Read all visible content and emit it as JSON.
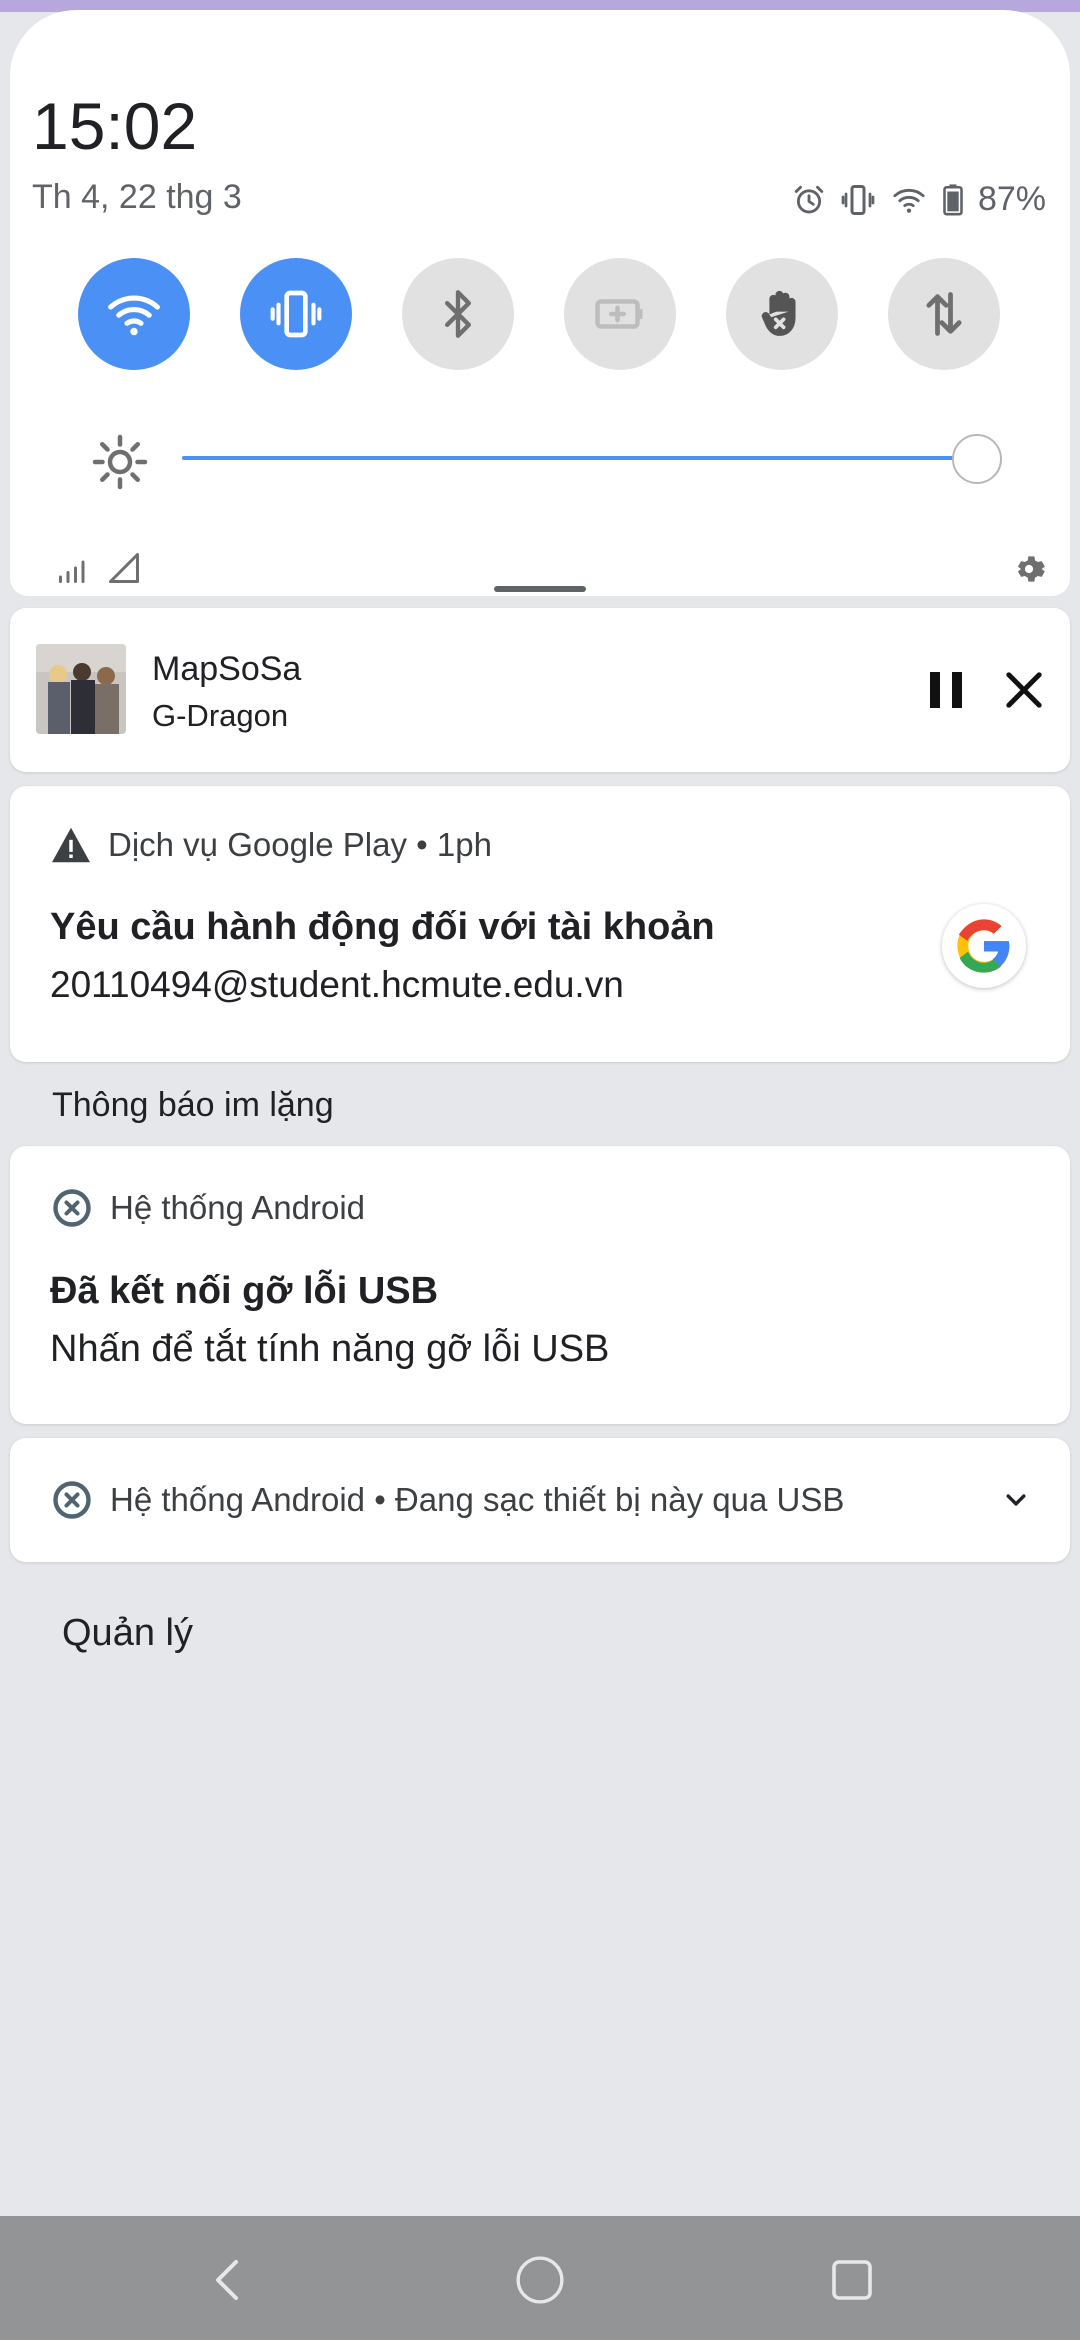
{
  "status_bar": {
    "time": "15:02",
    "date": "Th 4, 22 thg 3",
    "battery": "87%",
    "icons": [
      "alarm-icon",
      "vibrate-icon",
      "wifi-icon",
      "battery-icon"
    ]
  },
  "quick_settings": {
    "tiles": [
      {
        "icon": "wifi-icon",
        "state": "on"
      },
      {
        "icon": "vibrate-icon",
        "state": "on"
      },
      {
        "icon": "bluetooth-icon",
        "state": "off"
      },
      {
        "icon": "battery-saver-icon",
        "state": "off"
      },
      {
        "icon": "do-not-disturb-hand-icon",
        "state": "off"
      },
      {
        "icon": "mobile-data-icon",
        "state": "off"
      }
    ],
    "brightness_level": 1.0,
    "accent_color": "#4a90f5"
  },
  "media": {
    "title": "MapSoSa",
    "artist": "G-Dragon"
  },
  "notifications": {
    "gplay": {
      "app_line": "Dịch vụ Google Play • 1ph",
      "title": "Yêu cầu hành động đối với tài khoản",
      "text": "20110494@student.hcmute.edu.vn"
    },
    "silent_header": "Thông báo im lặng",
    "usb_debug": {
      "app_line": "Hệ thống Android",
      "title": "Đã kết nối gỡ lỗi USB",
      "text": "Nhấn để tắt tính năng gỡ lỗi USB"
    },
    "charging": {
      "app_line": "Hệ thống Android • Đang sạc thiết bị này qua USB"
    }
  },
  "manage_label": "Quản lý",
  "navigation": {
    "buttons": [
      "back-icon",
      "home-icon",
      "recents-icon"
    ]
  }
}
